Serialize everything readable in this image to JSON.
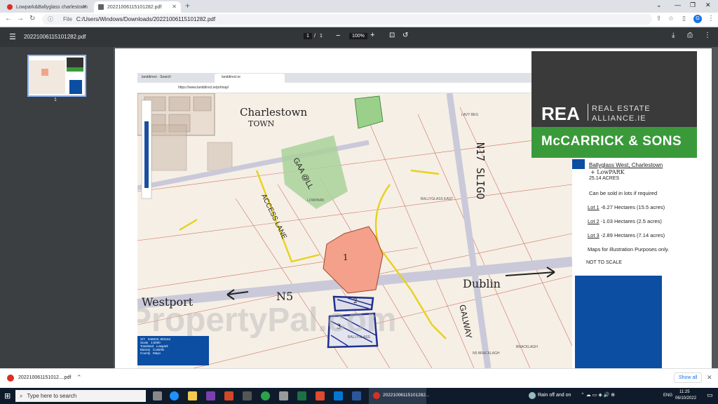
{
  "browser": {
    "tabs": [
      {
        "title": "Lowpark&Ballyglass charlestown",
        "favicon_color": "#d93025"
      },
      {
        "title": "20221006115101282.pdf",
        "favicon_color": "#5f6368"
      }
    ],
    "address": {
      "scheme": "File",
      "path": "C:/Users/Windows/Downloads/20221006115101282.pdf"
    }
  },
  "pdf_toolbar": {
    "filename": "20221006115101282.pdf",
    "page_current": "1",
    "page_sep": "/",
    "page_total": "1",
    "zoom": "100%"
  },
  "sidebar": {
    "thumb_page": "1"
  },
  "document": {
    "browser_in_doc": {
      "tab1": "landdirect - Search",
      "tab2": "landdirect.ie",
      "url": "https://www.landdirect.ie/prtmap/"
    },
    "map_labels": {
      "charlestown": "Charlestown",
      "town": "TOWN",
      "gaa": "GAA @LL",
      "n17": "N17 SLIGO",
      "access_lane": "ACCESS LANE",
      "dublin": "Dublin",
      "westport": "Westport",
      "n5": "N5",
      "galway": "GALWAY",
      "lowpark": "LOWPARK",
      "ballyglass_east": "BALLYGLASS EAST",
      "lavy_beg": "LAVY BEG",
      "ballyglass": "BALLYGLASS",
      "bracklagh": "BRACKLAGH",
      "n5_bracklagh": "N5 BRACKLAGH",
      "lot_1": "1",
      "lot_2": "2",
      "lot_3": "3"
    },
    "info_box": {
      "rows": [
        {
          "k": "X/Y",
          "v": "546818, 801164"
        },
        {
          "k": "Scale",
          "v": "1:5000"
        },
        {
          "k": "Townland",
          "v": "Lowpark"
        },
        {
          "k": "Barony",
          "v": "Costello"
        },
        {
          "k": "County",
          "v": "Mayo"
        }
      ]
    },
    "brand": {
      "rea": "REA",
      "real_estate": "REAL ESTATE",
      "alliance": "ALLIANCE.IE",
      "mccarrick": "McCARRICK & SONS",
      "green": "#3a9a3a"
    },
    "listing": {
      "location": "Ballyglass West, Charlestown",
      "handwritten": "+ LowPARK",
      "acres": "25.14 ACRES",
      "lots_note": "Can be sold in lots if required",
      "lots": [
        {
          "label": "Lot 1",
          "text": " -6.27 Hectares (15.5 acres)"
        },
        {
          "label": "Lot 2",
          "text": " -1.03 Hectares (2.5 acres)"
        },
        {
          "label": "Lot 3",
          "text": " -2.89 Hectares (7.14 acres)"
        }
      ],
      "maps_note": "Maps for illustration Purposes only.",
      "not_to_scale": "NOT TO SCALE"
    },
    "watermark": "PropertyPal.com",
    "blue": "#0b4ea2"
  },
  "download_bar": {
    "file": "202210061151012....pdf",
    "show_all": "Show all"
  },
  "taskbar": {
    "search_placeholder": "Type here to search",
    "active_app": "20221006115101282...",
    "weather": "Rain off and on",
    "lang": "ENG",
    "time": "11:25",
    "date": "06/10/2022"
  }
}
